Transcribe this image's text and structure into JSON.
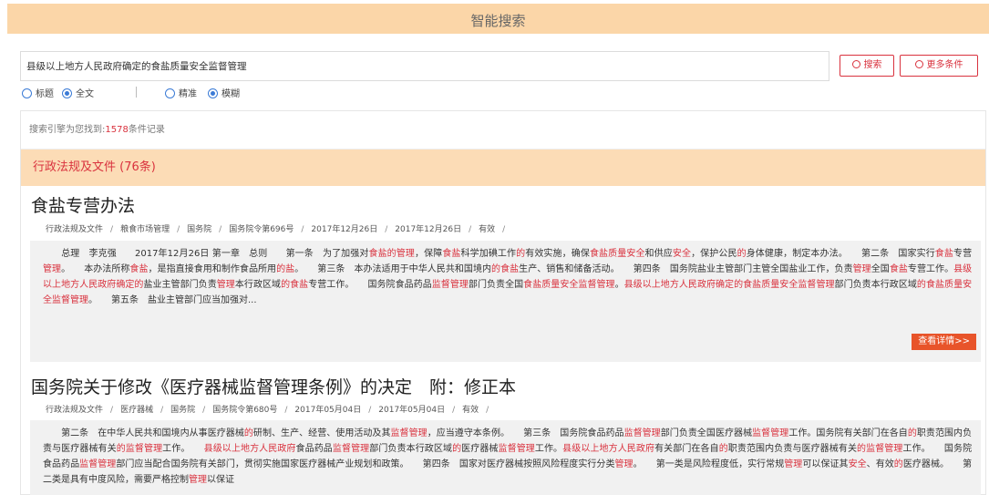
{
  "header": {
    "title": "智能搜索"
  },
  "search": {
    "query": "县级以上地方人民政府确定的食盐质量安全监督管理",
    "search_button": "搜索",
    "more_button": "更多条件"
  },
  "options": {
    "scope": [
      {
        "label": "标题",
        "checked": false
      },
      {
        "label": "全文",
        "checked": true
      }
    ],
    "match": [
      {
        "label": "精准",
        "checked": false
      },
      {
        "label": "模糊",
        "checked": true
      }
    ]
  },
  "summary": {
    "prefix": "搜索引擎为您找到:",
    "count": "1578",
    "suffix": "条件记录"
  },
  "category": {
    "label": "行政法规及文件 (76条)"
  },
  "colors": {
    "accent": "#d9323e",
    "header_bg": "#fbd6a8",
    "category_bg": "#fcdcb6",
    "detail_button": "#e8542a"
  },
  "results": [
    {
      "title": "食盐专营办法",
      "meta": [
        "行政法规及文件",
        "粮食市场管理",
        "国务院",
        "国务院令第696号",
        "2017年12月26日",
        "2017年12月26日",
        "有效"
      ],
      "snippet": [
        {
          "t": "　　总理　李克强　　2017年12月26日 第一章　总则　　第一条　为了加强对"
        },
        {
          "t": "食盐的管理",
          "h": true
        },
        {
          "t": "，保障"
        },
        {
          "t": "食盐",
          "h": true
        },
        {
          "t": "科学加碘工作"
        },
        {
          "t": "的",
          "h": true
        },
        {
          "t": "有效实施，确保"
        },
        {
          "t": "食盐质量安全",
          "h": true
        },
        {
          "t": "和供应"
        },
        {
          "t": "安全",
          "h": true
        },
        {
          "t": "，保护公民"
        },
        {
          "t": "的",
          "h": true
        },
        {
          "t": "身体健康，制定本办法。　　第二条　国家实行"
        },
        {
          "t": "食盐",
          "h": true
        },
        {
          "t": "专营"
        },
        {
          "t": "管理",
          "h": true
        },
        {
          "t": "。　　本办法所称"
        },
        {
          "t": "食盐",
          "h": true
        },
        {
          "t": "，是指直接食用和制作食品所用"
        },
        {
          "t": "的盐",
          "h": true
        },
        {
          "t": "。　　第三条　本办法适用于中华人民共和国境内"
        },
        {
          "t": "的食盐",
          "h": true
        },
        {
          "t": "生产、销售和储备活动。　　第四条　国务院盐业主管部门主管全国盐业工作，负责"
        },
        {
          "t": "管理",
          "h": true
        },
        {
          "t": "全国"
        },
        {
          "t": "食盐",
          "h": true
        },
        {
          "t": "专营工作。"
        },
        {
          "t": "县级以上地方人民政府确定的",
          "h": true
        },
        {
          "t": "盐业主管部门负责"
        },
        {
          "t": "管理",
          "h": true
        },
        {
          "t": "本行政区域"
        },
        {
          "t": "的食盐",
          "h": true
        },
        {
          "t": "专营工作。　　国务院食品药品"
        },
        {
          "t": "监督管理",
          "h": true
        },
        {
          "t": "部门负责全国"
        },
        {
          "t": "食盐质量安全监督管理",
          "h": true
        },
        {
          "t": "。"
        },
        {
          "t": "县级以上地方人民政府确定的食盐质量安全监督管理",
          "h": true
        },
        {
          "t": "部门负责本行政区域"
        },
        {
          "t": "的食盐质量安全监督管理",
          "h": true
        },
        {
          "t": "。　　第五条　盐业主管部门应当加强对..."
        }
      ],
      "detail_label": "查看详情>>"
    },
    {
      "title": "国务院关于修改《医疗器械监督管理条例》的决定　附：修正本",
      "meta": [
        "行政法规及文件",
        "医疗器械",
        "国务院",
        "国务院令第680号",
        "2017年05月04日",
        "2017年05月04日",
        "有效"
      ],
      "snippet": [
        {
          "t": "　　第二条　在中华人民共和国境内从事医疗器械"
        },
        {
          "t": "的",
          "h": true
        },
        {
          "t": "研制、生产、经营、使用活动及其"
        },
        {
          "t": "监督管理",
          "h": true
        },
        {
          "t": "，应当遵守本条例。　　第三条　国务院食品药品"
        },
        {
          "t": "监督管理",
          "h": true
        },
        {
          "t": "部门负责全国医疗器械"
        },
        {
          "t": "监督管理",
          "h": true
        },
        {
          "t": "工作。国务院有关部门在各自"
        },
        {
          "t": "的",
          "h": true
        },
        {
          "t": "职责范围内负责与医疗器械有关"
        },
        {
          "t": "的监督管理",
          "h": true
        },
        {
          "t": "工作。　　"
        },
        {
          "t": "县级以上地方人民政府",
          "h": true
        },
        {
          "t": "食品药品"
        },
        {
          "t": "监督管理",
          "h": true
        },
        {
          "t": "部门负责本行政区域"
        },
        {
          "t": "的",
          "h": true
        },
        {
          "t": "医疗器械"
        },
        {
          "t": "监督管理",
          "h": true
        },
        {
          "t": "工作。"
        },
        {
          "t": "县级以上地方人民政府",
          "h": true
        },
        {
          "t": "有关部门在各自"
        },
        {
          "t": "的",
          "h": true
        },
        {
          "t": "职责范围内负责与医疗器械有关"
        },
        {
          "t": "的监督管理",
          "h": true
        },
        {
          "t": "工作。　　国务院食品药品"
        },
        {
          "t": "监督管理",
          "h": true
        },
        {
          "t": "部门应当配合国务院有关部门，贯彻实施国家医疗器械产业规划和政策。　　第四条　国家对医疗器械按照风险程度实行分类"
        },
        {
          "t": "管理",
          "h": true
        },
        {
          "t": "。　　第一类是风险程度低，实行常规"
        },
        {
          "t": "管理",
          "h": true
        },
        {
          "t": "可以保证其"
        },
        {
          "t": "安全",
          "h": true
        },
        {
          "t": "、有效"
        },
        {
          "t": "的",
          "h": true
        },
        {
          "t": "医疗器械。　　第二类是具有中度风险，需要严格控制"
        },
        {
          "t": "管理",
          "h": true
        },
        {
          "t": "以保证"
        }
      ]
    }
  ]
}
